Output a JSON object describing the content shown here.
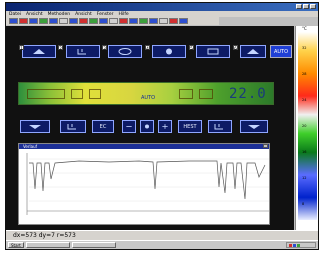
{
  "window": {
    "title": ""
  },
  "menu": {
    "items": [
      "Datei",
      "Ansicht",
      "Methoden",
      "Ansicht",
      "Fenster",
      "Hilfe"
    ]
  },
  "controls": {
    "button_numbers": [
      "1",
      "2",
      "3",
      "4",
      "5",
      "6"
    ],
    "bottom_labels": [
      "EC",
      "HEST"
    ],
    "auto_label": "AUTO"
  },
  "band": {
    "label": "AUTO",
    "digits": "22.0"
  },
  "plot": {
    "window_title": "Verlauf"
  },
  "scale": {
    "title": "°C",
    "ticks": [
      "32",
      "28",
      "24",
      "20",
      "16",
      "12",
      "8"
    ]
  },
  "status": {
    "text": "dx=573 dy=7 r=573"
  },
  "taskbar": {
    "start_label": "Start",
    "tasks": [
      "",
      ""
    ]
  }
}
